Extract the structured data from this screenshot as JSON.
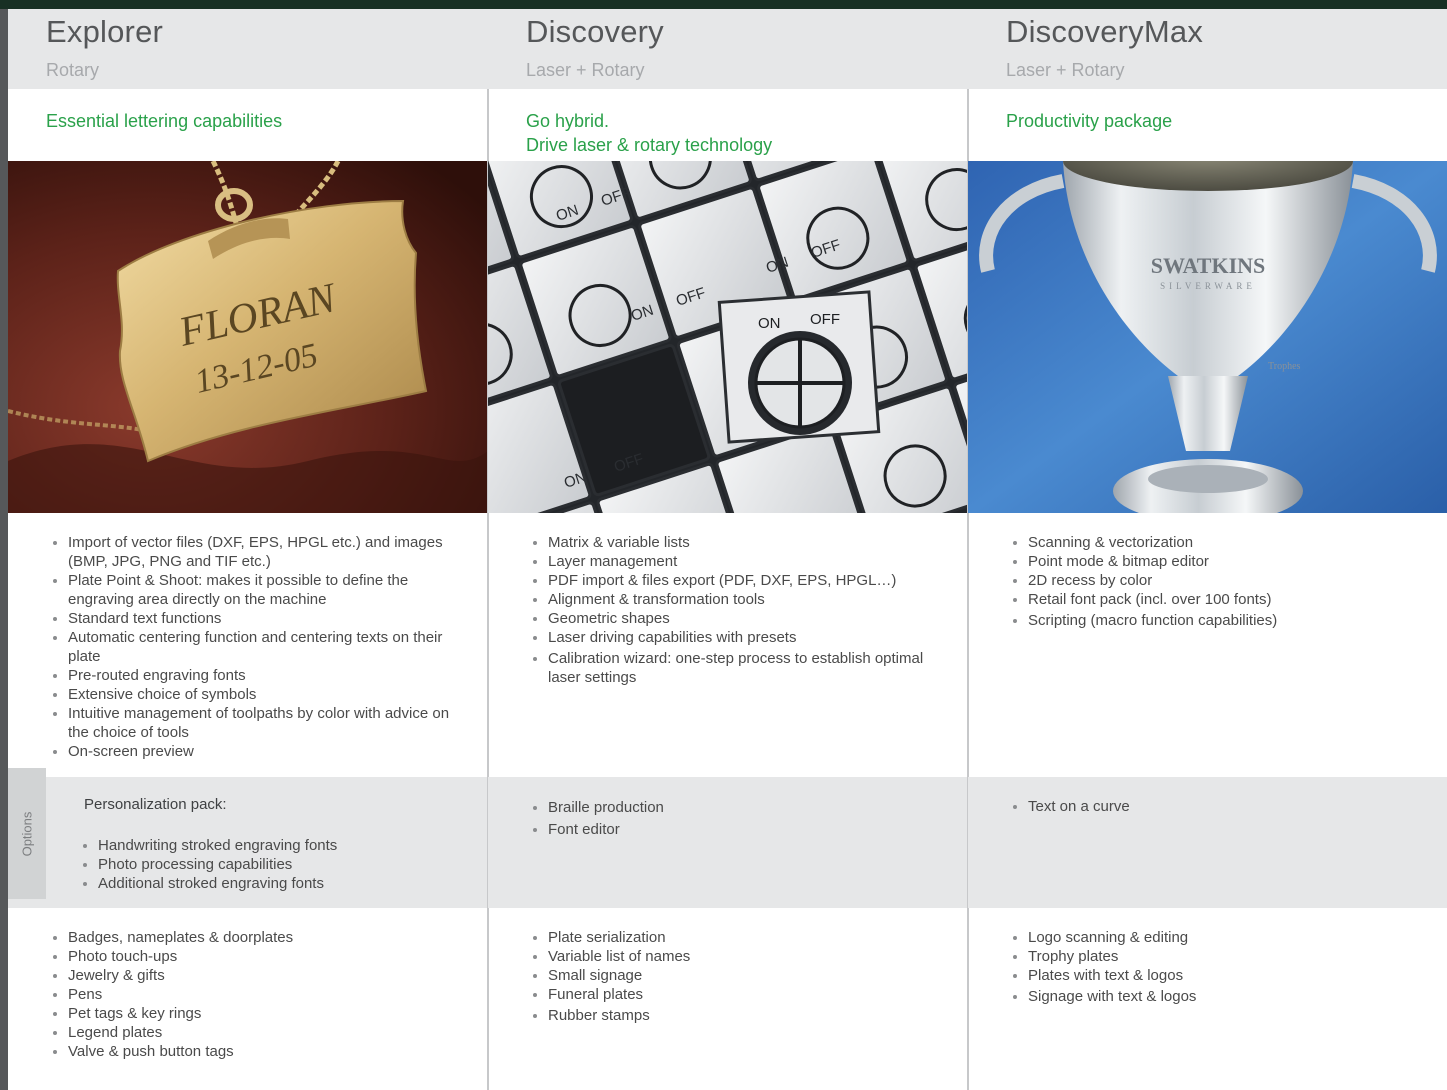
{
  "options_label": "Options",
  "products": [
    {
      "name": "Explorer",
      "subtitle": "Rotary",
      "tagline": [
        "Essential lettering capabilities"
      ],
      "image_icon": "engraved-gold-pendant-photo",
      "features": [
        "Import of vector files (DXF, EPS, HPGL etc.) and images (BMP, JPG, PNG and TIF etc.)",
        "Plate Point & Shoot: makes it possible to define the engraving area directly on the machine",
        "Standard text functions",
        "Automatic centering function and centering texts on their plate",
        "Pre-routed engraving fonts",
        "Extensive choice of symbols",
        "Intuitive management of toolpaths by color with advice on the choice of tools",
        "On-screen preview"
      ],
      "options_title": "Personalization pack:",
      "options": [
        "Handwriting stroked engraving fonts",
        "Photo processing capabilities",
        "Additional stroked engraving fonts"
      ],
      "applications": [
        "Badges, nameplates & doorplates",
        "Photo touch-ups",
        "Jewelry & gifts",
        "Pens",
        "Pet tags & key rings",
        "Legend plates",
        "Valve & push button tags"
      ],
      "photo_text": [
        "FLORAN",
        "13-12-05"
      ]
    },
    {
      "name": "Discovery",
      "subtitle": "Laser + Rotary",
      "tagline": [
        "Go hybrid.",
        "Drive laser & rotary technology"
      ],
      "image_icon": "on-off-switch-plates-photo",
      "features": [
        "Matrix & variable lists",
        "Layer management",
        "PDF import & files export (PDF, DXF, EPS, HPGL…)",
        "Alignment & transformation tools",
        "Geometric shapes",
        "Laser driving capabilities with presets",
        "Calibration wizard: one-step process to establish optimal laser settings"
      ],
      "options": [
        "Braille production",
        "Font editor"
      ],
      "applications": [
        "Plate serialization",
        "Variable list of names",
        "Small signage",
        "Funeral plates",
        "Rubber stamps"
      ],
      "photo_text": [
        "ON",
        "OFF"
      ]
    },
    {
      "name": "DiscoveryMax",
      "subtitle": "Laser + Rotary",
      "tagline": [
        "Productivity package"
      ],
      "image_icon": "silver-trophy-cup-photo",
      "features": [
        "Scanning & vectorization",
        "Point mode & bitmap editor",
        "2D recess by color",
        "Retail font pack (incl. over 100 fonts)",
        "Scripting (macro function capabilities)"
      ],
      "options": [
        "Text on a curve"
      ],
      "applications": [
        "Logo scanning & editing",
        "Trophy plates",
        "Plates with text & logos",
        "Signage with text & logos"
      ],
      "photo_text": [
        "SWATKINS",
        "SILVERWARE",
        "Trophes"
      ]
    }
  ],
  "colors": {
    "accent_green": "#2aa14a",
    "header_gray": "#e6e7e8",
    "top_bar": "#183024",
    "trophy_background": "#3e7ec6"
  }
}
